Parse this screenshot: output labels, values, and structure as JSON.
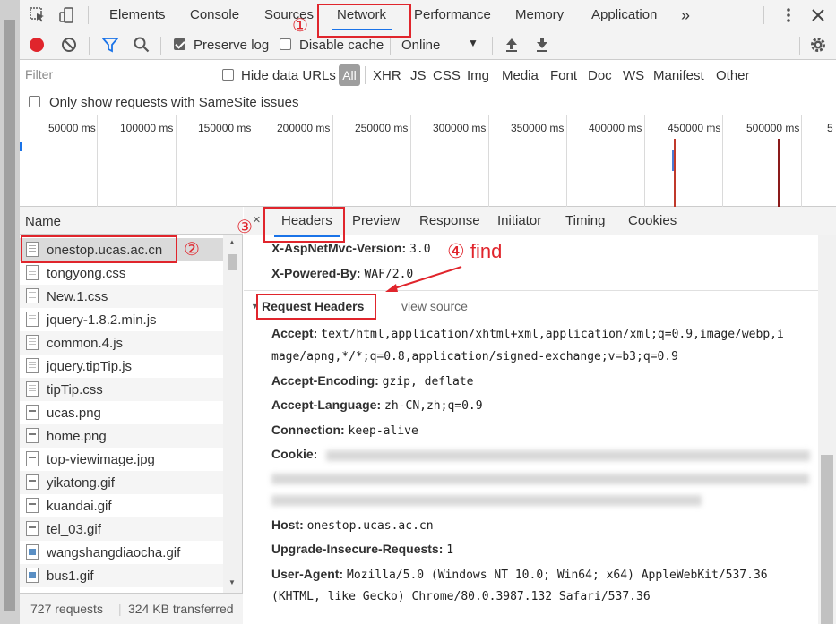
{
  "tabs": [
    "Elements",
    "Console",
    "Sources",
    "Network",
    "Performance",
    "Memory",
    "Application"
  ],
  "tabs_more": "»",
  "toolbar": {
    "preserve_log": "Preserve log",
    "disable_cache": "Disable cache",
    "throttle": "Online"
  },
  "filter": {
    "placeholder": "Filter",
    "hide_data_urls": "Hide data URLs",
    "types": [
      "All",
      "XHR",
      "JS",
      "CSS",
      "Img",
      "Media",
      "Font",
      "Doc",
      "WS",
      "Manifest",
      "Other"
    ]
  },
  "samesite_label": "Only show requests with SameSite issues",
  "overview_ticks": [
    "50000 ms",
    "100000 ms",
    "150000 ms",
    "200000 ms",
    "250000 ms",
    "300000 ms",
    "350000 ms",
    "400000 ms",
    "450000 ms",
    "500000 ms",
    "5"
  ],
  "list": {
    "header": "Name",
    "rows": [
      {
        "name": "onestop.ucas.ac.cn",
        "type": "doc"
      },
      {
        "name": "tongyong.css",
        "type": "css"
      },
      {
        "name": "New.1.css",
        "type": "css"
      },
      {
        "name": "jquery-1.8.2.min.js",
        "type": "js"
      },
      {
        "name": "common.4.js",
        "type": "js"
      },
      {
        "name": "jquery.tipTip.js",
        "type": "js"
      },
      {
        "name": "tipTip.css",
        "type": "css"
      },
      {
        "name": "ucas.png",
        "type": "img"
      },
      {
        "name": "home.png",
        "type": "img"
      },
      {
        "name": "top-viewimage.jpg",
        "type": "img"
      },
      {
        "name": "yikatong.gif",
        "type": "img"
      },
      {
        "name": "kuandai.gif",
        "type": "img"
      },
      {
        "name": "tel_03.gif",
        "type": "img"
      },
      {
        "name": "wangshangdiaocha.gif",
        "type": "gif"
      },
      {
        "name": "bus1.gif",
        "type": "gif"
      }
    ],
    "status_requests": "727 requests",
    "status_transferred": "324 KB transferred"
  },
  "detail": {
    "close": "×",
    "tabs": [
      "Headers",
      "Preview",
      "Response",
      "Initiator",
      "Timing",
      "Cookies"
    ],
    "response_headers": [
      {
        "key": "X-AspNetMvc-Version:",
        "value": "3.0"
      },
      {
        "key": "X-Powered-By:",
        "value": "WAF/2.0"
      }
    ],
    "request_headers_title": "Request Headers",
    "view_source": "view source",
    "accept_key": "Accept:",
    "accept_line1": "text/html,application/xhtml+xml,application/xml;q=0.9,image/webp,i",
    "accept_line2": "mage/apng,*/*;q=0.8,application/signed-exchange;v=b3;q=0.9",
    "accept_encoding_key": "Accept-Encoding:",
    "accept_encoding_val": "gzip, deflate",
    "accept_language_key": "Accept-Language:",
    "accept_language_val": "zh-CN,zh;q=0.9",
    "connection_key": "Connection:",
    "connection_val": "keep-alive",
    "cookie_key": "Cookie:",
    "host_key": "Host:",
    "host_val": "onestop.ucas.ac.cn",
    "upgrade_key": "Upgrade-Insecure-Requests:",
    "upgrade_val": "1",
    "ua_key": "User-Agent:",
    "ua_line1": "Mozilla/5.0 (Windows NT 10.0; Win64; x64) AppleWebKit/537.36",
    "ua_line2": "(KHTML, like Gecko) Chrome/80.0.3987.132 Safari/537.36"
  },
  "annotations": {
    "c1": "①",
    "c2": "②",
    "c3": "③",
    "c4": "④ find"
  },
  "colors": {
    "accent": "#1a73e8",
    "record": "#e0252c",
    "annotation": "#e0252c"
  }
}
